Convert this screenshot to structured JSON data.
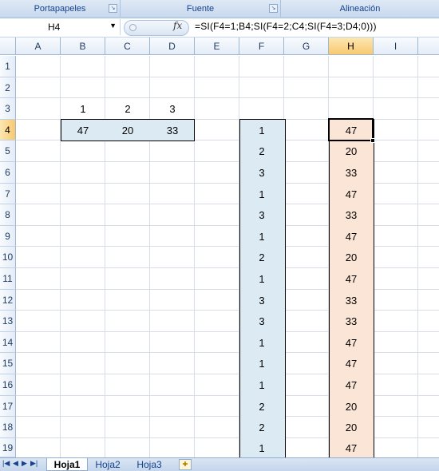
{
  "ribbon": {
    "groups": [
      {
        "label": "Portapapeles"
      },
      {
        "label": "Fuente"
      },
      {
        "label": "Alineación"
      }
    ]
  },
  "formula_bar": {
    "name_box": "H4",
    "fx_label": "fx",
    "formula": "=SI(F4=1;B4;SI(F4=2;C4;SI(F4=3;D4;0)))"
  },
  "grid": {
    "columns": [
      "A",
      "B",
      "C",
      "D",
      "E",
      "F",
      "G",
      "H",
      "I"
    ],
    "selected_column": "H",
    "rows": [
      "1",
      "2",
      "3",
      "4",
      "5",
      "6",
      "7",
      "8",
      "9",
      "10",
      "11",
      "12",
      "13",
      "14",
      "15",
      "16",
      "17",
      "18",
      "19"
    ],
    "selected_row": "4",
    "header_row3": [
      "1",
      "2",
      "3"
    ],
    "lookup_row4": [
      "47",
      "20",
      "33"
    ],
    "col_F": [
      "1",
      "2",
      "3",
      "1",
      "3",
      "1",
      "2",
      "1",
      "3",
      "3",
      "1",
      "1",
      "1",
      "2",
      "2",
      "1"
    ],
    "col_H": [
      "47",
      "20",
      "33",
      "47",
      "33",
      "47",
      "20",
      "47",
      "33",
      "33",
      "47",
      "47",
      "47",
      "20",
      "20",
      "47"
    ]
  },
  "sheet_tabs": {
    "tabs": [
      "Hoja1",
      "Hoja2",
      "Hoja3"
    ],
    "active": "Hoja1"
  }
}
